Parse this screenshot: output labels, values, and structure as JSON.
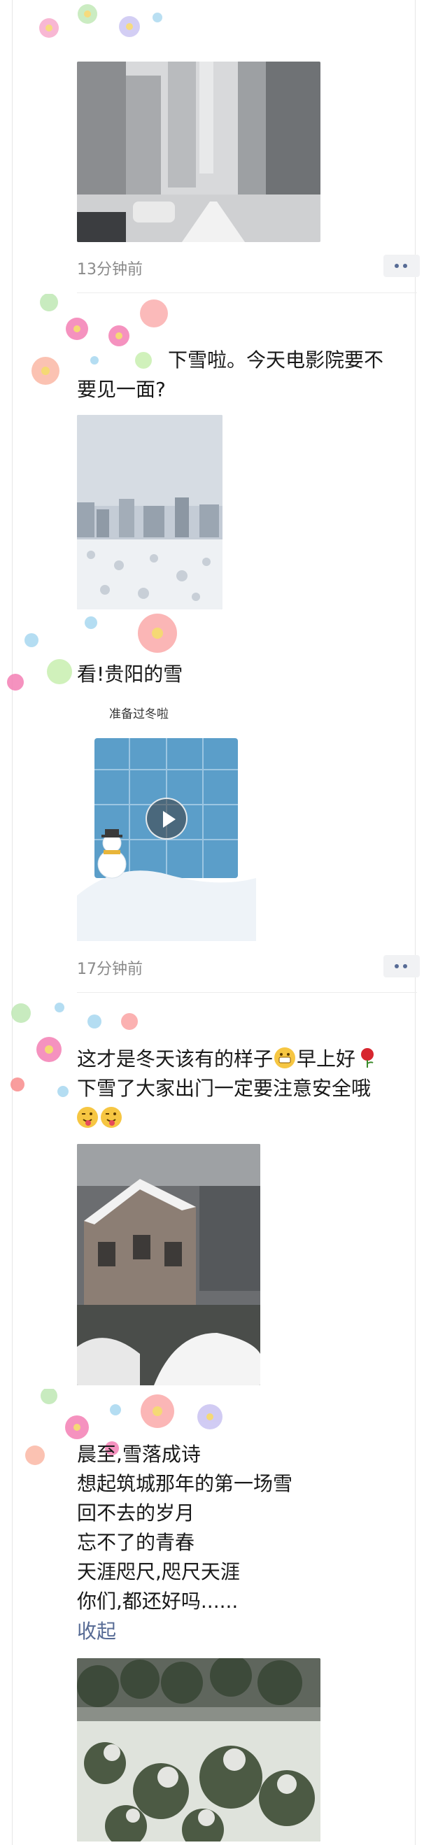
{
  "posts": [
    {
      "time": "13分钟前"
    },
    {
      "text_lines": [
        "下雪啦。今天电影院要不",
        "要见一面?"
      ],
      "caption": "看!贵阳的雪",
      "video_title": "准备过冬啦",
      "time": "17分钟前"
    },
    {
      "text_line_1_a": "这才是冬天该有的样子",
      "text_line_1_b": "早上好",
      "text_line_2": "下雪了大家出门一定要注意安全哦"
    },
    {
      "poem": [
        "晨至,雪落成诗",
        "想起筑城那年的第一场雪",
        "回不去的岁月",
        "忘不了的青春",
        "天涯咫尺,咫尺天涯",
        "你们,都还好吗......"
      ],
      "collapse_label": "收起"
    }
  ],
  "icons": {
    "more": "more-dots-icon",
    "emoji_grin": "grin-emoji-icon",
    "emoji_rose": "rose-emoji-icon",
    "emoji_wink": "wink-tongue-emoji-icon",
    "play": "play-icon"
  },
  "colors": {
    "link": "#576b95",
    "time": "#8a8a8a"
  }
}
